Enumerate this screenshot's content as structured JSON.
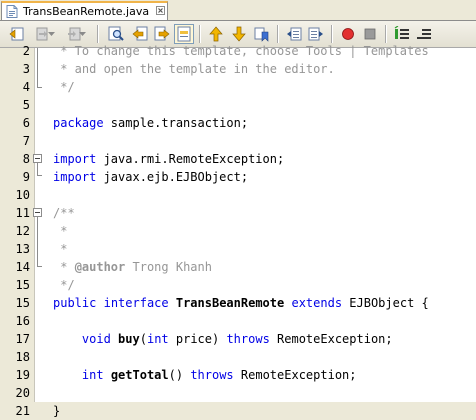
{
  "tab": {
    "title": "TransBeanRemote.java"
  },
  "toolbar": {
    "icons": [
      "back-icon",
      "nav-back-icon",
      "nav-forward-icon",
      "find-icon",
      "find-prev-icon",
      "find-next-icon",
      "toggle-highlight-icon",
      "prev-bookmark-icon",
      "next-bookmark-icon",
      "toggle-bookmark-icon",
      "shift-left-icon",
      "shift-right-icon",
      "start-macro-icon",
      "stop-macro-icon",
      "comment-icon",
      "uncomment-icon"
    ]
  },
  "colors": {
    "keyword": "#0000e6",
    "comment": "#969696",
    "tab_accent": "#f0b44a",
    "macro_red": "#e23030"
  },
  "editor": {
    "lines": [
      {
        "n": "2",
        "parts": [
          {
            "t": " * To change this template, choose Tools | Templates",
            "c": "cm"
          }
        ]
      },
      {
        "n": "3",
        "parts": [
          {
            "t": " * and open the template in the editor.",
            "c": "cm"
          }
        ]
      },
      {
        "n": "4",
        "parts": [
          {
            "t": " */",
            "c": "cm"
          }
        ]
      },
      {
        "n": "5",
        "parts": []
      },
      {
        "n": "6",
        "parts": [
          {
            "t": "package",
            "c": "kw"
          },
          {
            "t": " sample.transaction;",
            "c": ""
          }
        ]
      },
      {
        "n": "7",
        "parts": []
      },
      {
        "n": "8",
        "parts": [
          {
            "t": "import",
            "c": "kw"
          },
          {
            "t": " java.rmi.RemoteException;",
            "c": ""
          }
        ]
      },
      {
        "n": "9",
        "parts": [
          {
            "t": "import",
            "c": "kw"
          },
          {
            "t": " javax.ejb.EJBObject;",
            "c": ""
          }
        ]
      },
      {
        "n": "10",
        "parts": []
      },
      {
        "n": "11",
        "parts": [
          {
            "t": "/**",
            "c": "cm"
          }
        ]
      },
      {
        "n": "12",
        "parts": [
          {
            "t": " *",
            "c": "cm"
          }
        ]
      },
      {
        "n": "13",
        "parts": [
          {
            "t": " *",
            "c": "cm"
          }
        ]
      },
      {
        "n": "14",
        "parts": [
          {
            "t": " * ",
            "c": "cm"
          },
          {
            "t": "@author",
            "c": "cm b"
          },
          {
            "t": " Trong Khanh",
            "c": "cm"
          }
        ]
      },
      {
        "n": "15",
        "parts": [
          {
            "t": " */",
            "c": "cm"
          }
        ]
      },
      {
        "n": "15",
        "parts": [
          {
            "t": "public",
            "c": "kw"
          },
          {
            "t": " ",
            "c": ""
          },
          {
            "t": "interface",
            "c": "kw"
          },
          {
            "t": " ",
            "c": ""
          },
          {
            "t": "TransBeanRemote",
            "c": "b"
          },
          {
            "t": " ",
            "c": ""
          },
          {
            "t": "extends",
            "c": "kw"
          },
          {
            "t": " EJBObject {",
            "c": ""
          }
        ]
      },
      {
        "n": "16",
        "parts": []
      },
      {
        "n": "17",
        "parts": [
          {
            "t": "    ",
            "c": ""
          },
          {
            "t": "void",
            "c": "kw"
          },
          {
            "t": " ",
            "c": ""
          },
          {
            "t": "buy",
            "c": "b"
          },
          {
            "t": "(",
            "c": ""
          },
          {
            "t": "int",
            "c": "kw"
          },
          {
            "t": " price) ",
            "c": ""
          },
          {
            "t": "throws",
            "c": "kw"
          },
          {
            "t": " RemoteException;",
            "c": ""
          }
        ]
      },
      {
        "n": "18",
        "parts": []
      },
      {
        "n": "19",
        "parts": [
          {
            "t": "    ",
            "c": ""
          },
          {
            "t": "int",
            "c": "kw"
          },
          {
            "t": " ",
            "c": ""
          },
          {
            "t": "getTotal",
            "c": "b"
          },
          {
            "t": "() ",
            "c": ""
          },
          {
            "t": "throws",
            "c": "kw"
          },
          {
            "t": " RemoteException;",
            "c": ""
          }
        ]
      },
      {
        "n": "20",
        "parts": []
      },
      {
        "n": "21",
        "parts": [
          {
            "t": "}",
            "c": ""
          }
        ]
      }
    ]
  }
}
